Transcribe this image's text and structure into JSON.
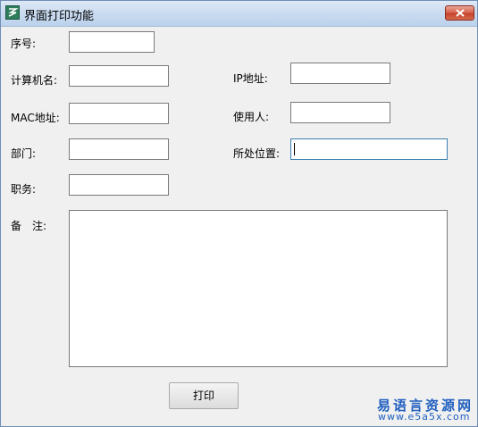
{
  "window": {
    "title": "界面打印功能",
    "icon": "app-logo-icon",
    "close_icon": "close-icon"
  },
  "form": {
    "serial_no": {
      "label": "序号:",
      "value": ""
    },
    "computer_name": {
      "label": "计算机名:",
      "value": ""
    },
    "ip_address": {
      "label": "IP地址:",
      "value": ""
    },
    "mac_address": {
      "label": "MAC地址:",
      "value": ""
    },
    "user": {
      "label": "使用人:",
      "value": ""
    },
    "department": {
      "label": "部门:",
      "value": ""
    },
    "location": {
      "label": "所处位置:",
      "value": ""
    },
    "position": {
      "label": "职务:",
      "value": ""
    },
    "remarks": {
      "label": "备　注:",
      "value": ""
    }
  },
  "print_button": {
    "label": "打印"
  },
  "watermark": {
    "brand": "易语言资源网",
    "url": "www.e5a5x.com"
  }
}
